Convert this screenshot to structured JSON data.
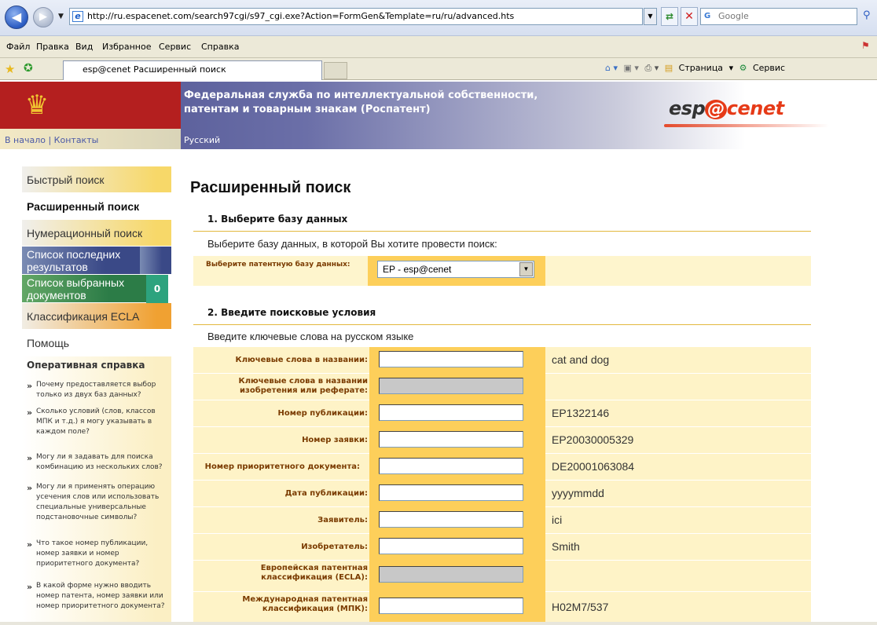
{
  "browser": {
    "url": "http://ru.espacenet.com/search97cgi/s97_cgi.exe?Action=FormGen&Template=ru/ru/advanced.hts",
    "search_placeholder": "Google",
    "menu": [
      "Файл",
      "Правка",
      "Вид",
      "Избранное",
      "Сервис",
      "Справка"
    ],
    "tab_title": "esp@cenet Расширенный поиск",
    "toolbar_page": "Страница",
    "toolbar_tools": "Сервис"
  },
  "header": {
    "agency": "Федеральная служба по интеллектуальной собственности, патентам и товарным знакам (Роспатент)",
    "links": "В начало | Контакты",
    "language": "Русский",
    "logo_esp": "esp",
    "logo_at": "@",
    "logo_cenet": "cenet",
    "accent": "#e63a17"
  },
  "sidebar": {
    "quick": "Быстрый поиск",
    "advanced": "Расширенный поиск",
    "number": "Нумерационный поиск",
    "last_results": "Список последних результатов",
    "selected": "Список выбранных документов",
    "selected_count": "0",
    "ecla": "Классификация ECLA",
    "help": "Помощь",
    "quick_help_title": "Оперативная справка",
    "questions": [
      "Почему предоставляется выбор только из двух баз данных?",
      "Сколько условий (слов, классов МПК и т.д.) я могу указывать в каждом поле?",
      "Могу ли я задавать для поиска комбинацию из нескольких слов?",
      "Могу ли я применять операцию усечения слов или использовать специальные универсальные подстановочные символы?",
      "Что такое номер публикации, номер заявки и номер приоритетного документа?",
      "В какой форме нужно вводить номер патента, номер заявки или номер приоритетного документа?"
    ]
  },
  "main": {
    "title": "Расширенный поиск",
    "section1_title": "1. Выберите базу данных",
    "section1_sub": "Выберите базу данных, в которой Вы хотите провести поиск:",
    "db_label": "Выберите патентную базу данных:",
    "db_value": "EP - esp@cenet",
    "section2_title": "2. Введите поисковые условия",
    "section2_sub": "Введите ключевые слова на русском языке",
    "fields": [
      {
        "label": "Ключевые слова в названии:",
        "example": "cat and dog"
      },
      {
        "label": "Ключевые слова в названии изобретения или реферате:",
        "example": ""
      },
      {
        "label": "Номер публикации:",
        "example": "EP1322146"
      },
      {
        "label": "Номер заявки:",
        "example": "EP20030005329"
      },
      {
        "label": "Номер приоритетного документа:",
        "example": "DE20001063084"
      },
      {
        "label": "Дата публикации:",
        "example": "yyyymmdd"
      },
      {
        "label": "Заявитель:",
        "example": "ici"
      },
      {
        "label": "Изобретатель:",
        "example": "Smith"
      },
      {
        "label": "Европейская патентная классификация (ECLA):",
        "example": ""
      },
      {
        "label": "Международная патентная классификация (МПК):",
        "example": "H02M7/537"
      }
    ]
  }
}
